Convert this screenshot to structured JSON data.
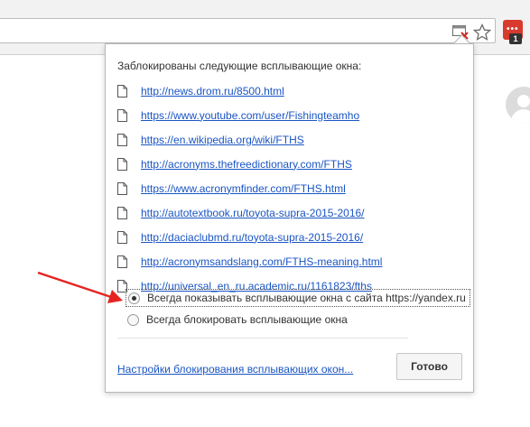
{
  "toolbar": {
    "icons": [
      "popup-blocked-icon",
      "star-icon",
      "extension-icon"
    ],
    "extension_badge": "1",
    "extension_color": "#d83a2e"
  },
  "bubble": {
    "title": "Заблокированы следующие всплывающие окна:",
    "popups": [
      "http://news.drom.ru/8500.html",
      "https://www.youtube.com/user/Fishingteamho",
      "https://en.wikipedia.org/wiki/FTHS",
      "http://acronyms.thefreedictionary.com/FTHS",
      "https://www.acronymfinder.com/FTHS.html",
      "http://autotextbook.ru/toyota-supra-2015-2016/",
      "http://daciaclubmd.ru/toyota-supra-2015-2016/",
      "http://acronymsandslang.com/FTHS-meaning.html",
      "http://universal_en_ru.academic.ru/1161823/fths"
    ],
    "options": [
      {
        "label": "Всегда показывать всплывающие окна с сайта https://yandex.ru",
        "checked": true
      },
      {
        "label": "Всегда блокировать всплывающие окна",
        "checked": false
      }
    ],
    "settings_link": "Настройки блокирования всплывающих окон...",
    "done_button": "Готово"
  },
  "colors": {
    "link": "#1a55c4",
    "annotation_arrow": "#e52421"
  }
}
